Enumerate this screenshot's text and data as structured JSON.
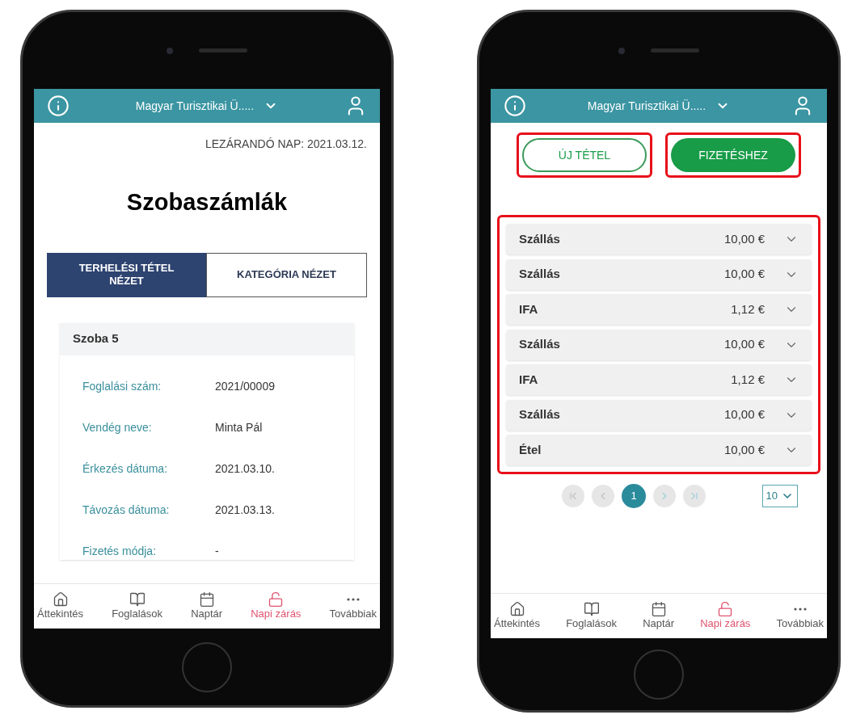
{
  "phones": [
    {
      "kind": "room_bills",
      "header": {
        "title": "Magyar Turisztikai Ü....."
      },
      "closing_day": "LEZÁRANDÓ NAP: 2021.03.12.",
      "title": "Szobaszámlák",
      "view_tabs": [
        {
          "label": "TERHELÉSI TÉTEL NÉZET",
          "selected": true
        },
        {
          "label": "KATEGÓRIA NÉZET",
          "selected": false
        }
      ],
      "room": {
        "name": "Szoba 5",
        "fields": [
          {
            "label": "Foglalási szám:",
            "value": "2021/00009"
          },
          {
            "label": "Vendég neve:",
            "value": "Minta Pál"
          },
          {
            "label": "Érkezés dátuma:",
            "value": "2021.03.10."
          },
          {
            "label": "Távozás dátuma:",
            "value": "2021.03.13."
          },
          {
            "label": "Fizetés módja:",
            "value": "-"
          }
        ]
      },
      "nav": [
        {
          "kind": "home",
          "label": "Áttekintés",
          "selected": false
        },
        {
          "kind": "book",
          "label": "Foglalások",
          "selected": false
        },
        {
          "kind": "calendar",
          "label": "Naptár",
          "selected": false
        },
        {
          "kind": "lock",
          "label": "Napi zárás",
          "selected": true
        },
        {
          "kind": "more",
          "label": "Továbbiak",
          "selected": false
        }
      ]
    },
    {
      "kind": "items",
      "header": {
        "title": "Magyar Turisztikai Ü....."
      },
      "actions": [
        {
          "label": "ÚJ TÉTEL",
          "kind": "outline",
          "highlighted": true
        },
        {
          "label": "FIZETÉSHEZ",
          "kind": "filled",
          "highlighted": true
        }
      ],
      "item_list": {
        "highlighted": true,
        "items": [
          {
            "name": "Szállás",
            "amount": "10,00 €"
          },
          {
            "name": "Szállás",
            "amount": "10,00 €"
          },
          {
            "name": "IFA",
            "amount": "1,12 €"
          },
          {
            "name": "Szállás",
            "amount": "10,00 €"
          },
          {
            "name": "IFA",
            "amount": "1,12 €"
          },
          {
            "name": "Szállás",
            "amount": "10,00 €"
          },
          {
            "name": "Étel",
            "amount": "10,00 €"
          }
        ]
      },
      "pagination": {
        "pages": [
          {
            "label": "1",
            "selected": true
          }
        ],
        "page_size": "10"
      },
      "nav": [
        {
          "kind": "home",
          "label": "Áttekintés",
          "selected": false
        },
        {
          "kind": "book",
          "label": "Foglalások",
          "selected": false
        },
        {
          "kind": "calendar",
          "label": "Naptár",
          "selected": false
        },
        {
          "kind": "lock",
          "label": "Napi zárás",
          "selected": true
        },
        {
          "kind": "more",
          "label": "Továbbiak",
          "selected": false
        }
      ]
    }
  ]
}
